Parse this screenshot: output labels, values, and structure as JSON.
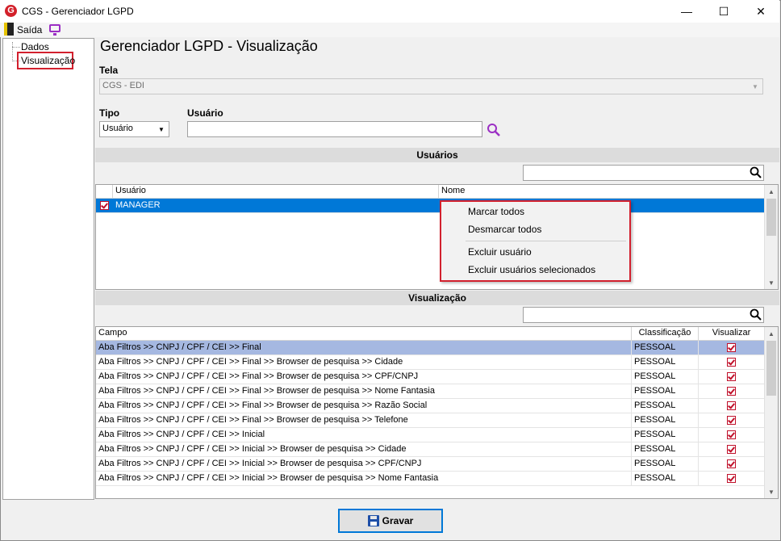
{
  "window": {
    "title": "CGS - Gerenciador LGPD",
    "icon_letter": "G",
    "controls": {
      "minimize": "—",
      "maximize": "☐",
      "close": "✕"
    }
  },
  "menubar": {
    "exit_label": "Saída"
  },
  "tree": {
    "items": [
      {
        "label": "Dados"
      },
      {
        "label": "Visualização",
        "selected": true
      }
    ]
  },
  "page_title": "Gerenciador LGPD - Visualização",
  "tela": {
    "label": "Tela",
    "value": "CGS - EDI"
  },
  "tipo": {
    "label": "Tipo",
    "value": "Usuário"
  },
  "usuario_field": {
    "label": "Usuário",
    "value": ""
  },
  "users_section": {
    "title": "Usuários",
    "search_value": "",
    "columns": [
      "Usuário",
      "Nome"
    ],
    "rows": [
      {
        "checked": true,
        "usuario": "MANAGER",
        "nome": ""
      }
    ]
  },
  "context_menu": {
    "items": [
      "Marcar todos",
      "Desmarcar todos",
      "Excluir usuário",
      "Excluir usuários selecionados"
    ]
  },
  "view_section": {
    "title": "Visualização",
    "search_value": "",
    "columns": [
      "Campo",
      "Classificação",
      "Visualizar"
    ],
    "rows": [
      {
        "campo": "Aba Filtros >> CNPJ / CPF / CEI >> Final",
        "classificacao": "PESSOAL",
        "visualizar": true
      },
      {
        "campo": "Aba Filtros >> CNPJ / CPF / CEI >> Final >> Browser de pesquisa >> Cidade",
        "classificacao": "PESSOAL",
        "visualizar": true
      },
      {
        "campo": "Aba Filtros >> CNPJ / CPF / CEI >> Final >> Browser de pesquisa >> CPF/CNPJ",
        "classificacao": "PESSOAL",
        "visualizar": true
      },
      {
        "campo": "Aba Filtros >> CNPJ / CPF / CEI >> Final >> Browser de pesquisa >> Nome Fantasia",
        "classificacao": "PESSOAL",
        "visualizar": true
      },
      {
        "campo": "Aba Filtros >> CNPJ / CPF / CEI >> Final >> Browser de pesquisa >> Razão Social",
        "classificacao": "PESSOAL",
        "visualizar": true
      },
      {
        "campo": "Aba Filtros >> CNPJ / CPF / CEI >> Final >> Browser de pesquisa >> Telefone",
        "classificacao": "PESSOAL",
        "visualizar": true
      },
      {
        "campo": "Aba Filtros >> CNPJ / CPF / CEI >> Inicial",
        "classificacao": "PESSOAL",
        "visualizar": true
      },
      {
        "campo": "Aba Filtros >> CNPJ / CPF / CEI >> Inicial >> Browser de pesquisa >> Cidade",
        "classificacao": "PESSOAL",
        "visualizar": true
      },
      {
        "campo": "Aba Filtros >> CNPJ / CPF / CEI >> Inicial >> Browser de pesquisa >> CPF/CNPJ",
        "classificacao": "PESSOAL",
        "visualizar": true
      },
      {
        "campo": "Aba Filtros >> CNPJ / CPF / CEI >> Inicial >> Browser de pesquisa >> Nome Fantasia",
        "classificacao": "PESSOAL",
        "visualizar": true
      }
    ]
  },
  "save_button": {
    "label": "Gravar"
  },
  "colors": {
    "accent_red": "#d2202e",
    "selection_blue": "#0078d7",
    "selection_light": "#a5b8e1",
    "search_icon_purple": "#9b2fc4"
  },
  "icons": {
    "app": "app-logo-icon",
    "exit": "exit-door-icon",
    "monitor": "monitor-icon",
    "search": "search-icon",
    "save": "floppy-disk-icon"
  }
}
